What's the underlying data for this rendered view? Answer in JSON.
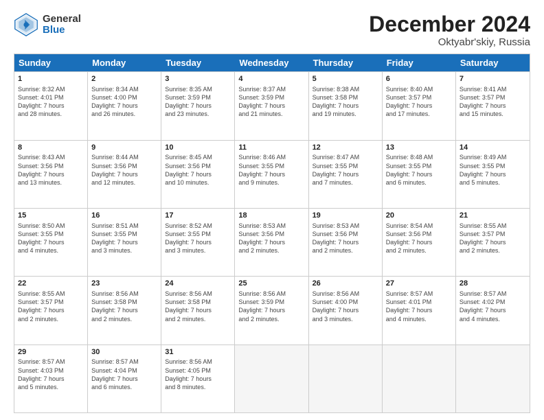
{
  "logo": {
    "general": "General",
    "blue": "Blue"
  },
  "title": "December 2024",
  "location": "Oktyabr'skiy, Russia",
  "days_of_week": [
    "Sunday",
    "Monday",
    "Tuesday",
    "Wednesday",
    "Thursday",
    "Friday",
    "Saturday"
  ],
  "weeks": [
    [
      {
        "day": "1",
        "lines": [
          "Sunrise: 8:32 AM",
          "Sunset: 4:01 PM",
          "Daylight: 7 hours",
          "and 28 minutes."
        ]
      },
      {
        "day": "2",
        "lines": [
          "Sunrise: 8:34 AM",
          "Sunset: 4:00 PM",
          "Daylight: 7 hours",
          "and 26 minutes."
        ]
      },
      {
        "day": "3",
        "lines": [
          "Sunrise: 8:35 AM",
          "Sunset: 3:59 PM",
          "Daylight: 7 hours",
          "and 23 minutes."
        ]
      },
      {
        "day": "4",
        "lines": [
          "Sunrise: 8:37 AM",
          "Sunset: 3:59 PM",
          "Daylight: 7 hours",
          "and 21 minutes."
        ]
      },
      {
        "day": "5",
        "lines": [
          "Sunrise: 8:38 AM",
          "Sunset: 3:58 PM",
          "Daylight: 7 hours",
          "and 19 minutes."
        ]
      },
      {
        "day": "6",
        "lines": [
          "Sunrise: 8:40 AM",
          "Sunset: 3:57 PM",
          "Daylight: 7 hours",
          "and 17 minutes."
        ]
      },
      {
        "day": "7",
        "lines": [
          "Sunrise: 8:41 AM",
          "Sunset: 3:57 PM",
          "Daylight: 7 hours",
          "and 15 minutes."
        ]
      }
    ],
    [
      {
        "day": "8",
        "lines": [
          "Sunrise: 8:43 AM",
          "Sunset: 3:56 PM",
          "Daylight: 7 hours",
          "and 13 minutes."
        ]
      },
      {
        "day": "9",
        "lines": [
          "Sunrise: 8:44 AM",
          "Sunset: 3:56 PM",
          "Daylight: 7 hours",
          "and 12 minutes."
        ]
      },
      {
        "day": "10",
        "lines": [
          "Sunrise: 8:45 AM",
          "Sunset: 3:56 PM",
          "Daylight: 7 hours",
          "and 10 minutes."
        ]
      },
      {
        "day": "11",
        "lines": [
          "Sunrise: 8:46 AM",
          "Sunset: 3:55 PM",
          "Daylight: 7 hours",
          "and 9 minutes."
        ]
      },
      {
        "day": "12",
        "lines": [
          "Sunrise: 8:47 AM",
          "Sunset: 3:55 PM",
          "Daylight: 7 hours",
          "and 7 minutes."
        ]
      },
      {
        "day": "13",
        "lines": [
          "Sunrise: 8:48 AM",
          "Sunset: 3:55 PM",
          "Daylight: 7 hours",
          "and 6 minutes."
        ]
      },
      {
        "day": "14",
        "lines": [
          "Sunrise: 8:49 AM",
          "Sunset: 3:55 PM",
          "Daylight: 7 hours",
          "and 5 minutes."
        ]
      }
    ],
    [
      {
        "day": "15",
        "lines": [
          "Sunrise: 8:50 AM",
          "Sunset: 3:55 PM",
          "Daylight: 7 hours",
          "and 4 minutes."
        ]
      },
      {
        "day": "16",
        "lines": [
          "Sunrise: 8:51 AM",
          "Sunset: 3:55 PM",
          "Daylight: 7 hours",
          "and 3 minutes."
        ]
      },
      {
        "day": "17",
        "lines": [
          "Sunrise: 8:52 AM",
          "Sunset: 3:55 PM",
          "Daylight: 7 hours",
          "and 3 minutes."
        ]
      },
      {
        "day": "18",
        "lines": [
          "Sunrise: 8:53 AM",
          "Sunset: 3:56 PM",
          "Daylight: 7 hours",
          "and 2 minutes."
        ]
      },
      {
        "day": "19",
        "lines": [
          "Sunrise: 8:53 AM",
          "Sunset: 3:56 PM",
          "Daylight: 7 hours",
          "and 2 minutes."
        ]
      },
      {
        "day": "20",
        "lines": [
          "Sunrise: 8:54 AM",
          "Sunset: 3:56 PM",
          "Daylight: 7 hours",
          "and 2 minutes."
        ]
      },
      {
        "day": "21",
        "lines": [
          "Sunrise: 8:55 AM",
          "Sunset: 3:57 PM",
          "Daylight: 7 hours",
          "and 2 minutes."
        ]
      }
    ],
    [
      {
        "day": "22",
        "lines": [
          "Sunrise: 8:55 AM",
          "Sunset: 3:57 PM",
          "Daylight: 7 hours",
          "and 2 minutes."
        ]
      },
      {
        "day": "23",
        "lines": [
          "Sunrise: 8:56 AM",
          "Sunset: 3:58 PM",
          "Daylight: 7 hours",
          "and 2 minutes."
        ]
      },
      {
        "day": "24",
        "lines": [
          "Sunrise: 8:56 AM",
          "Sunset: 3:58 PM",
          "Daylight: 7 hours",
          "and 2 minutes."
        ]
      },
      {
        "day": "25",
        "lines": [
          "Sunrise: 8:56 AM",
          "Sunset: 3:59 PM",
          "Daylight: 7 hours",
          "and 2 minutes."
        ]
      },
      {
        "day": "26",
        "lines": [
          "Sunrise: 8:56 AM",
          "Sunset: 4:00 PM",
          "Daylight: 7 hours",
          "and 3 minutes."
        ]
      },
      {
        "day": "27",
        "lines": [
          "Sunrise: 8:57 AM",
          "Sunset: 4:01 PM",
          "Daylight: 7 hours",
          "and 4 minutes."
        ]
      },
      {
        "day": "28",
        "lines": [
          "Sunrise: 8:57 AM",
          "Sunset: 4:02 PM",
          "Daylight: 7 hours",
          "and 4 minutes."
        ]
      }
    ],
    [
      {
        "day": "29",
        "lines": [
          "Sunrise: 8:57 AM",
          "Sunset: 4:03 PM",
          "Daylight: 7 hours",
          "and 5 minutes."
        ]
      },
      {
        "day": "30",
        "lines": [
          "Sunrise: 8:57 AM",
          "Sunset: 4:04 PM",
          "Daylight: 7 hours",
          "and 6 minutes."
        ]
      },
      {
        "day": "31",
        "lines": [
          "Sunrise: 8:56 AM",
          "Sunset: 4:05 PM",
          "Daylight: 7 hours",
          "and 8 minutes."
        ]
      },
      {
        "day": "",
        "lines": []
      },
      {
        "day": "",
        "lines": []
      },
      {
        "day": "",
        "lines": []
      },
      {
        "day": "",
        "lines": []
      }
    ]
  ]
}
